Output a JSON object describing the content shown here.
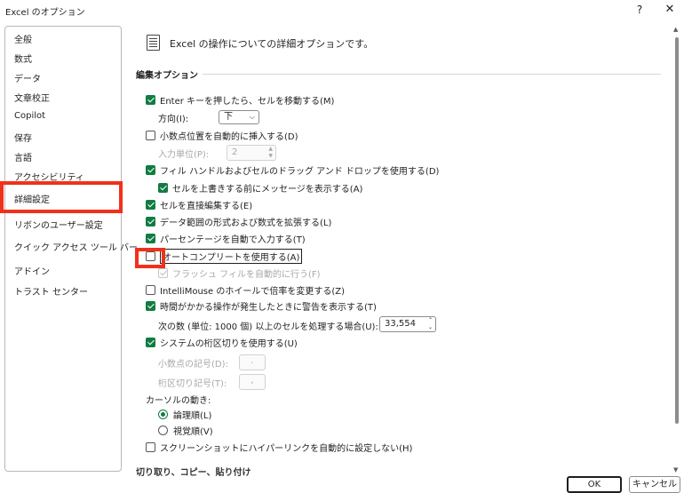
{
  "window": {
    "title": "Excel のオプション",
    "help": "?",
    "close": "✕"
  },
  "sidebar": {
    "items": [
      {
        "label": "全般"
      },
      {
        "label": "数式"
      },
      {
        "label": "データ"
      },
      {
        "label": "文章校正"
      },
      {
        "label": "Copilot"
      },
      {
        "label": "保存"
      },
      {
        "label": "言語"
      },
      {
        "label": "アクセシビリティ"
      },
      {
        "label": "詳細設定"
      },
      {
        "label": "リボンのユーザー設定"
      },
      {
        "label": "クイック アクセス ツール バー"
      },
      {
        "label": "アドイン"
      },
      {
        "label": "トラスト センター"
      }
    ],
    "selected": "詳細設定"
  },
  "header": {
    "text": "Excel の操作についての詳細オプションです。",
    "icon": "document-icon"
  },
  "section": {
    "title": "編集オプション"
  },
  "options": {
    "enter_move": "Enter キーを押したら、セルを移動する(M)",
    "direction_label": "方向(I):",
    "direction_value": "下",
    "auto_decimal": "小数点位置を自動的に挿入する(D)",
    "places_label": "入力単位(P):",
    "places_value": "2",
    "fill_handle": "フィル ハンドルおよびセルのドラッグ アンド ドロップを使用する(D)",
    "overwrite_alert": "セルを上書きする前にメッセージを表示する(A)",
    "direct_edit": "セルを直接編集する(E)",
    "extend_formats": "データ範囲の形式および数式を拡張する(L)",
    "auto_percent": "パーセンテージを自動で入力する(T)",
    "autocomplete": "オートコンプリートを使用する(A)",
    "flash_fill": "フラッシュ フィルを自動的に行う(F)",
    "intellimouse": "IntelliMouse のホイールで倍率を変更する(Z)",
    "alert_slow": "時間がかかる操作が発生したときに警告を表示する(T)",
    "cells_label": "次の数 (単位: 1000 個) 以上のセルを処理する場合(U):",
    "cells_value": "33,554",
    "system_separators": "システムの桁区切りを使用する(U)",
    "decimal_sep_label": "小数点の記号(D):",
    "decimal_sep_value": ".",
    "thousands_sep_label": "桁区切り記号(T):",
    "thousands_sep_value": ",",
    "cursor_label": "カーソルの動き:",
    "logical": "論理順(L)",
    "visual": "視覚順(V)",
    "no_hyperlink": "スクリーンショットにハイパーリンクを自動的に設定しない(H)"
  },
  "next_section": "切り取り、コピー、貼り付け",
  "buttons": {
    "ok": "OK",
    "cancel": "キャンセル"
  },
  "colors": {
    "accent": "#107c41",
    "highlight": "#f0311b"
  }
}
